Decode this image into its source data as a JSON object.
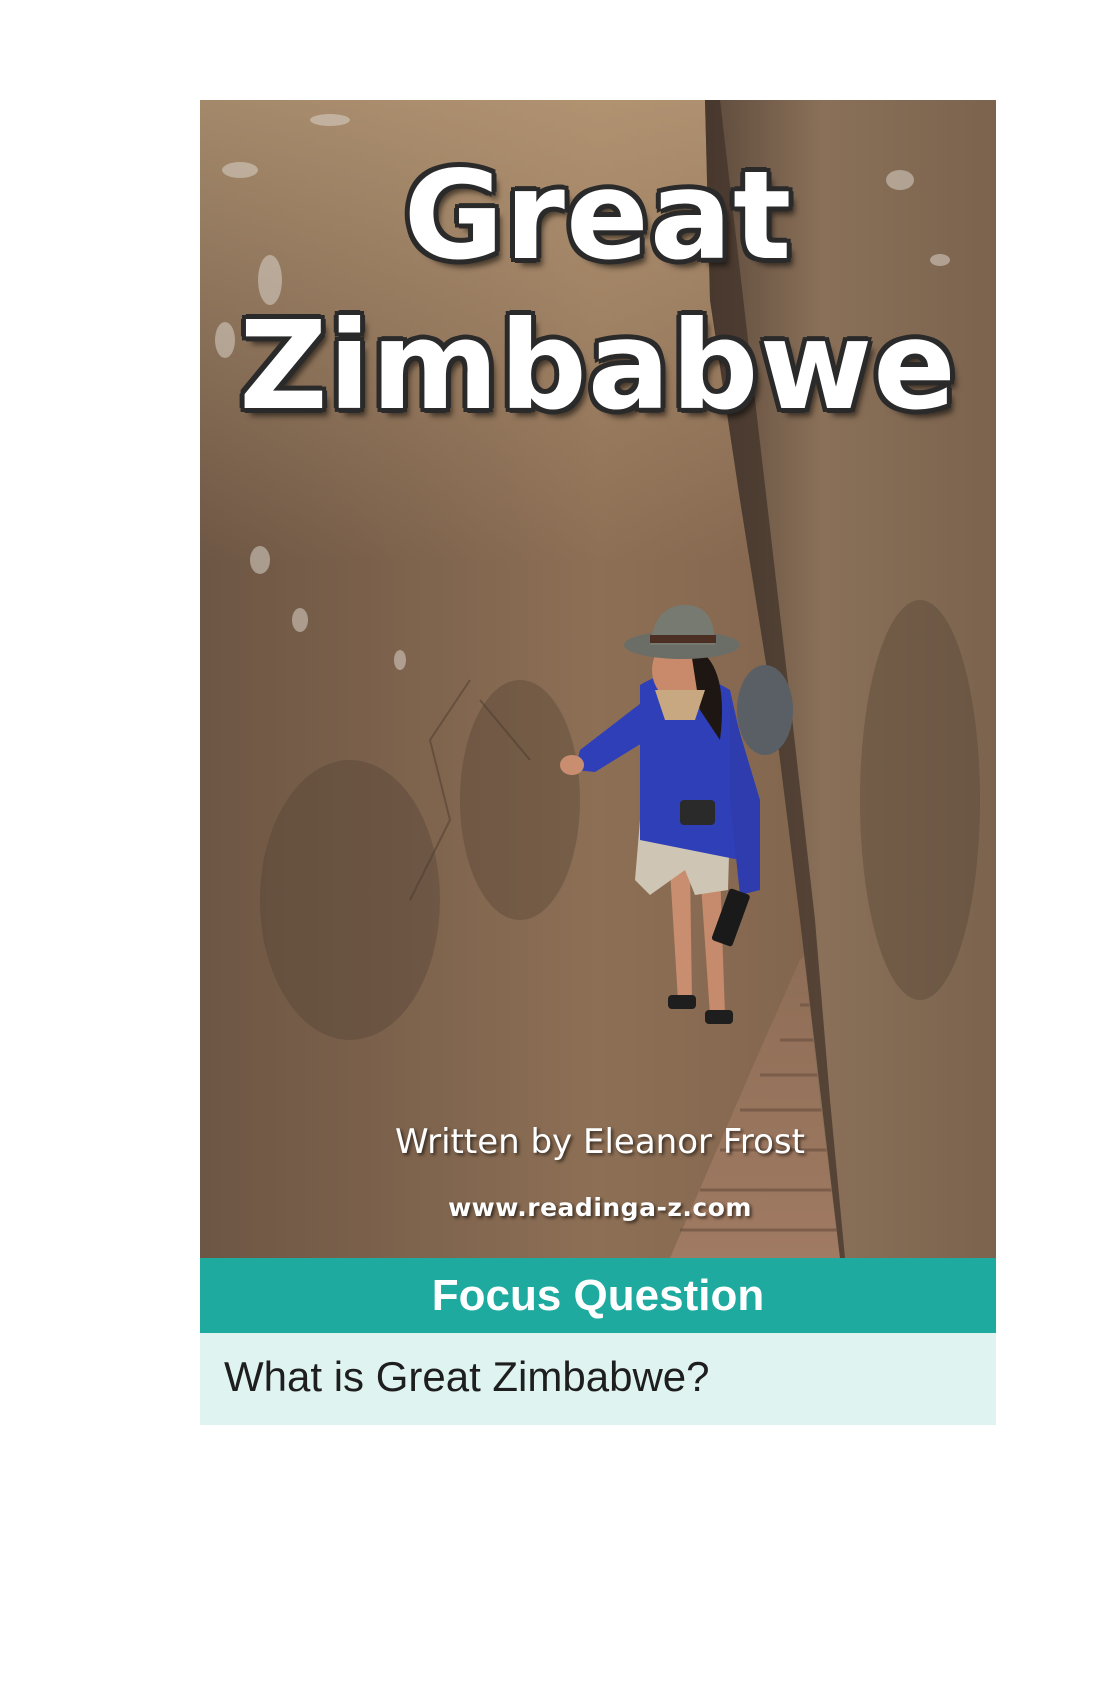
{
  "cover": {
    "title_line1": "Great",
    "title_line2": "Zimbabwe",
    "byline": "Written by Eleanor Frost",
    "website": "www.readinga-z.com"
  },
  "focus": {
    "header": "Focus Question",
    "question": "What is Great Zimbabwe?"
  },
  "colors": {
    "focus_header": "#1faaa0",
    "focus_body": "#dff3f1",
    "rock": "#8a6c52"
  }
}
